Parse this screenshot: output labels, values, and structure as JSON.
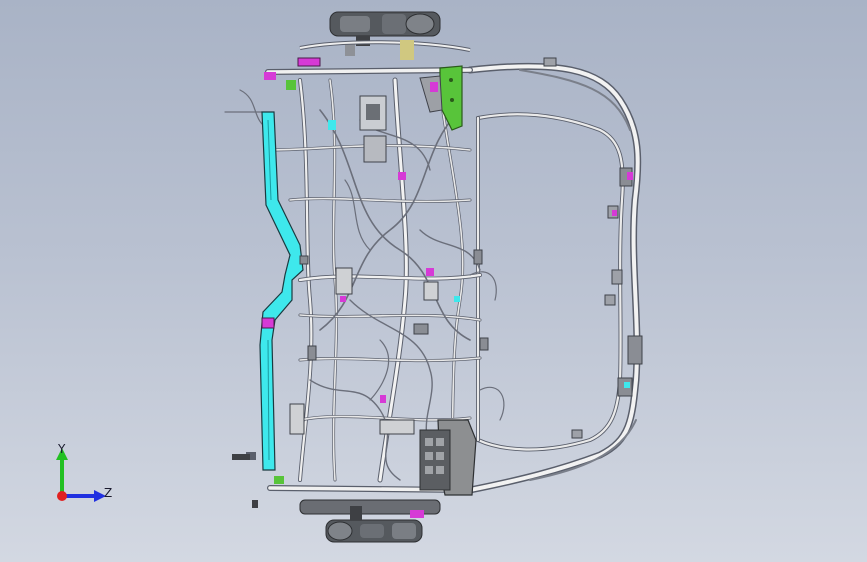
{
  "viewport": {
    "background_top": "#a9b3c6",
    "background_bottom": "#d3d8e2"
  },
  "model": {
    "description_icon": "wiring-harness-assembly-icon",
    "colors": {
      "wire": "#e6e6e6",
      "wire_shadow": "#6c7080",
      "trough_cyan": "#3ee8ec",
      "bracket_green": "#58c43a",
      "connector_magenta": "#d63ad6",
      "body_dark": "#4e5052",
      "fuse_box_gray": "#8d8f91"
    }
  },
  "triad": {
    "y_label": "Y",
    "z_label": "Z",
    "y_color": "#22c022",
    "z_color": "#2030e0",
    "origin_color": "#e02020"
  }
}
